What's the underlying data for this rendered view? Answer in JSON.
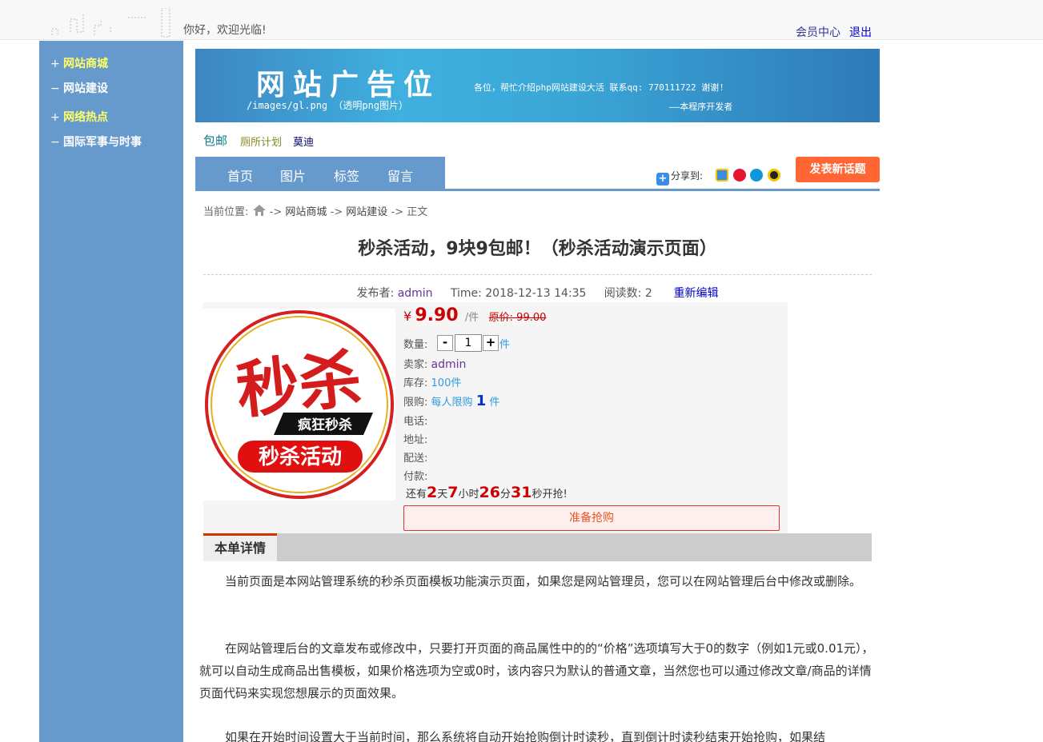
{
  "header": {
    "welcome": "你好，欢迎光临!",
    "member_center": "会员中心",
    "logout": "退出"
  },
  "sidebar": {
    "items": [
      {
        "sign": "+",
        "label": "网站商城"
      },
      {
        "sign": "−",
        "label": "网站建设"
      },
      {
        "sign": "+",
        "label": "网络热点"
      },
      {
        "sign": "−",
        "label": "国际军事与时事"
      }
    ]
  },
  "banner": {
    "title": "网站广告位",
    "sub": "/images/gl.png （透明png图片）",
    "ad": "各位，帮忙介绍php网站建设大活  联系qq: 770111722 谢谢!",
    "by": "——本程序开发者"
  },
  "tags": [
    "包邮",
    "厕所计划",
    "莫迪"
  ],
  "nav": {
    "items": [
      "首页",
      "图片",
      "标签",
      "留言"
    ],
    "share_label": "分享到:",
    "post_button": "发表新话题"
  },
  "breadcrumb": {
    "prefix": "当前位置:",
    "sep": "->",
    "items": [
      "网站商城",
      "网站建设",
      "正文"
    ]
  },
  "article": {
    "title": "秒杀活动，9块9包邮！（秒杀活动演示页面）",
    "publisher_label": "发布者:",
    "publisher": "admin",
    "time": "Time: 2018-12-13 14:35",
    "views_label": "阅读数:",
    "views": "2",
    "reedit": "重新编辑"
  },
  "product": {
    "image_text_main": "秒杀",
    "image_text_tag": "疯狂秒杀",
    "image_text_bottom": "秒杀活动",
    "currency": "¥",
    "price": "9.90",
    "unit": "/件",
    "original_price": "原价: 99.00",
    "qty_label": "数量:",
    "qty_minus": "-",
    "qty_value": "1",
    "qty_plus": "+",
    "qty_unit": "件",
    "seller_label": "卖家:",
    "seller": "admin",
    "stock_label": "库存:",
    "stock": "100件",
    "limit_label": "限购:",
    "limit_text": "每人限购",
    "limit_num": "1",
    "limit_unit": "件",
    "phone_label": "电话:",
    "address_label": "地址:",
    "delivery_label": "配送:",
    "payment_label": "付款:",
    "countdown": {
      "prefix": "还有",
      "days": "2",
      "days_unit": "天",
      "hours": "7",
      "hours_unit": "小时",
      "minutes": "26",
      "minutes_unit": "分",
      "seconds": "31",
      "suffix": "秒开抢!"
    },
    "buy_button": "准备抢购"
  },
  "detail": {
    "tab": "本单详情",
    "paragraphs": [
      "当前页面是本网站管理系统的秒杀页面模板功能演示页面，如果您是网站管理员，您可以在网站管理后台中修改或删除。",
      "在网站管理后台的文章发布或修改中，只要打开页面的商品属性中的的“价格”选项填写大于0的数字（例如1元或0.01元），就可以自动生成商品出售模板，如果价格选项为空或0时，该内容只为默认的普通文章，当然您也可以通过修改文章/商品的详情页面代码来实现您想展示的页面效果。",
      "如果在开始时间设置大于当前时间，那么系统将自动开始抢购倒计时读秒，直到倒计时读秒结束开始抢购，如果结"
    ]
  },
  "colors": {
    "sidebar_bg": "#6699cc",
    "nav_bg": "#6699cc",
    "post_button_bg": "#ff6633",
    "price": "#cc0000",
    "sidebar_highlight": "#ffff66"
  }
}
